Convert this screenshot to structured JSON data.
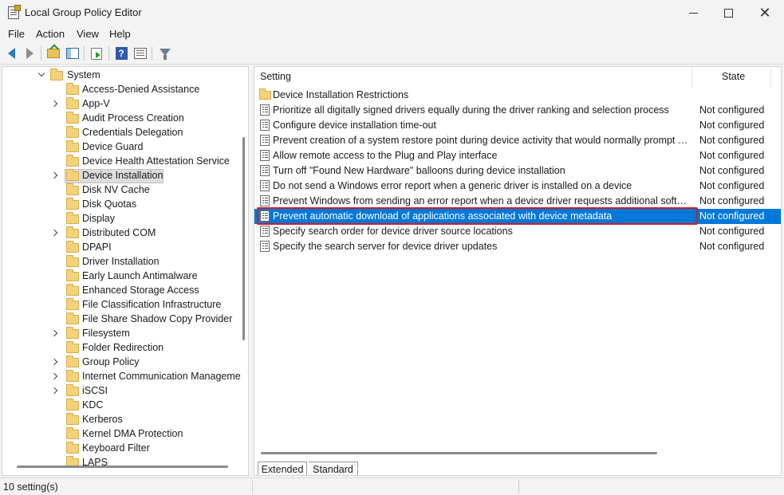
{
  "window": {
    "title": "Local Group Policy Editor"
  },
  "menu": [
    "File",
    "Action",
    "View",
    "Help"
  ],
  "tree": {
    "parent": "System",
    "items": [
      {
        "label": "Access-Denied Assistance",
        "expandable": false
      },
      {
        "label": "App-V",
        "expandable": true
      },
      {
        "label": "Audit Process Creation",
        "expandable": false
      },
      {
        "label": "Credentials Delegation",
        "expandable": false
      },
      {
        "label": "Device Guard",
        "expandable": false
      },
      {
        "label": "Device Health Attestation Service",
        "expandable": false
      },
      {
        "label": "Device Installation",
        "expandable": true,
        "selected": true
      },
      {
        "label": "Disk NV Cache",
        "expandable": false
      },
      {
        "label": "Disk Quotas",
        "expandable": false
      },
      {
        "label": "Display",
        "expandable": false
      },
      {
        "label": "Distributed COM",
        "expandable": true
      },
      {
        "label": "DPAPI",
        "expandable": false
      },
      {
        "label": "Driver Installation",
        "expandable": false
      },
      {
        "label": "Early Launch Antimalware",
        "expandable": false
      },
      {
        "label": "Enhanced Storage Access",
        "expandable": false
      },
      {
        "label": "File Classification Infrastructure",
        "expandable": false
      },
      {
        "label": "File Share Shadow Copy Provider",
        "expandable": false
      },
      {
        "label": "Filesystem",
        "expandable": true
      },
      {
        "label": "Folder Redirection",
        "expandable": false
      },
      {
        "label": "Group Policy",
        "expandable": true
      },
      {
        "label": "Internet Communication Manageme",
        "expandable": true
      },
      {
        "label": "iSCSI",
        "expandable": true
      },
      {
        "label": "KDC",
        "expandable": false
      },
      {
        "label": "Kerberos",
        "expandable": false
      },
      {
        "label": "Kernel DMA Protection",
        "expandable": false
      },
      {
        "label": "Keyboard Filter",
        "expandable": false
      },
      {
        "label": "LAPS",
        "expandable": false
      }
    ]
  },
  "list": {
    "headers": {
      "setting": "Setting",
      "state": "State"
    },
    "rows": [
      {
        "setting": "Device Installation Restrictions",
        "state": "",
        "type": "folder"
      },
      {
        "setting": "Prioritize all digitally signed drivers equally during the driver ranking and selection process",
        "state": "Not configured",
        "type": "setting"
      },
      {
        "setting": "Configure device installation time-out",
        "state": "Not configured",
        "type": "setting"
      },
      {
        "setting": "Prevent creation of a system restore point during device activity that would normally prompt creation of a restore point",
        "state": "Not configured",
        "type": "setting"
      },
      {
        "setting": "Allow remote access to the Plug and Play interface",
        "state": "Not configured",
        "type": "setting"
      },
      {
        "setting": "Turn off \"Found New Hardware\" balloons during device installation",
        "state": "Not configured",
        "type": "setting"
      },
      {
        "setting": "Do not send a Windows error report when a generic driver is installed on a device",
        "state": "Not configured",
        "type": "setting"
      },
      {
        "setting": "Prevent Windows from sending an error report when a device driver requests additional software during installation",
        "state": "Not configured",
        "type": "setting"
      },
      {
        "setting": "Prevent automatic download of applications associated with device metadata",
        "state": "Not configured",
        "type": "setting",
        "selected": true
      },
      {
        "setting": "Specify search order for device driver source locations",
        "state": "Not configured",
        "type": "setting"
      },
      {
        "setting": "Specify the search server for device driver updates",
        "state": "Not configured",
        "type": "setting"
      }
    ]
  },
  "tabs": [
    "Extended",
    "Standard"
  ],
  "status": {
    "text": "10 setting(s)"
  },
  "colors": {
    "selection": "#0078d7",
    "highlight_border": "#d01c27",
    "folder": "#f4d27a"
  }
}
